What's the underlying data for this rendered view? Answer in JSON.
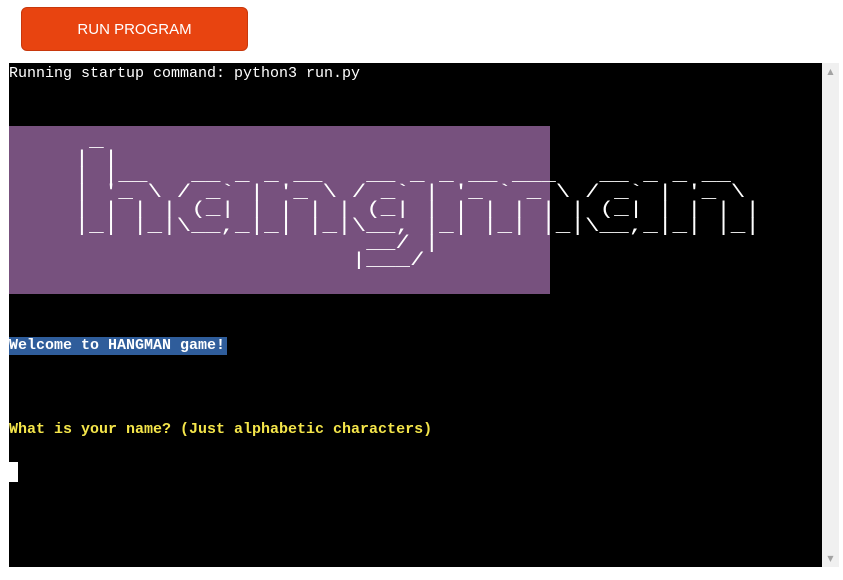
{
  "toolbar": {
    "run_label": "RUN PROGRAM",
    "run_color": "#e84410"
  },
  "terminal": {
    "startup_text": "Running startup command: python3 run.py",
    "banner_art": "  _\n | |\n | |__   __ _ _ __   __ _ _ __ ___   __ _ _ __\n | '_ \\ / _` | '_ \\ / _` | '_ ` _ \\ / _` | '_ \\\n | | | | (_| | | | | (_| | | | | | | (_| | | | |\n |_| |_|\\__,_|_| |_|\\__, |_| |_| |_|\\__,_|_| |_|\n                     __/ |\n                    |___/",
    "banner_color": "#77517e",
    "welcome_text": "Welcome to HANGMAN game!",
    "welcome_highlight_color": "#2f5d9b",
    "question_text": "What is your name? (Just alphabetic characters)",
    "question_color": "#f4e54a"
  },
  "scrollbar": {
    "up_icon": "triangle-up-icon",
    "down_icon": "triangle-down-icon",
    "up_glyph": "▲",
    "down_glyph": "▼"
  }
}
